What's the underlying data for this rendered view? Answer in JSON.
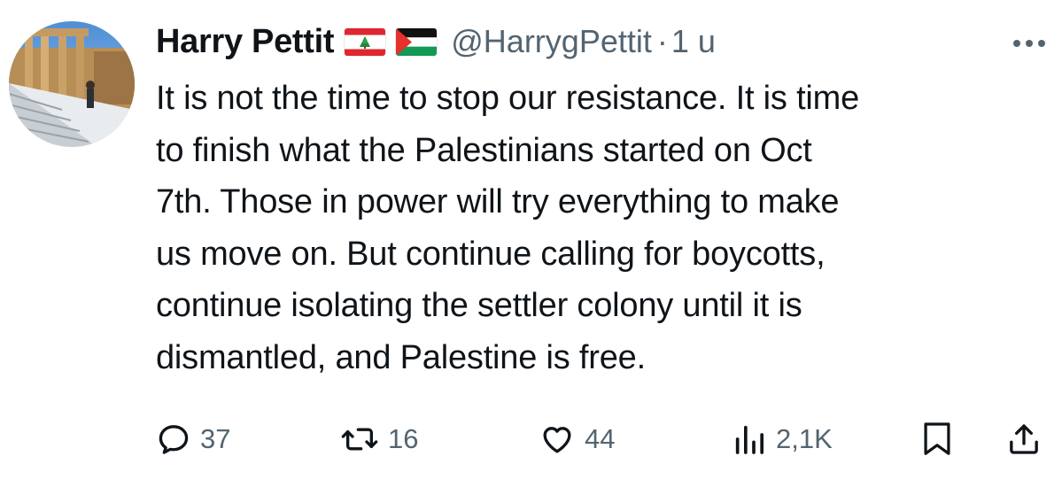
{
  "tweet": {
    "author": {
      "display_name": "Harry Pettit",
      "handle": "@HarrygPettit",
      "flags": [
        "lebanon-flag-icon",
        "palestine-flag-icon"
      ]
    },
    "separator": "·",
    "time": "1 u",
    "text": "It is not the time to stop our resistance. It is time to finish what the Palestinians started on Oct 7th. Those in power will try everything to make us move on. But continue calling for boycotts, continue isolating the settler colony until it is dismantled, and Palestine is free.",
    "text_lines": [
      "It is not the time to stop our resistance. It is time",
      "to finish what the Palestinians started on Oct",
      "7th. Those in power will try everything to make",
      "us move on. But continue calling for boycotts,",
      "continue isolating the settler colony until it is",
      "dismantled, and Palestine is free."
    ],
    "actions": {
      "reply": {
        "icon": "reply-icon",
        "count": "37"
      },
      "repost": {
        "icon": "repost-icon",
        "count": "16"
      },
      "like": {
        "icon": "heart-icon",
        "count": "44"
      },
      "views": {
        "icon": "views-icon",
        "count": "2,1K"
      },
      "bookmark": {
        "icon": "bookmark-icon"
      },
      "share": {
        "icon": "share-icon"
      }
    }
  },
  "colors": {
    "text_primary": "#0f1419",
    "text_secondary": "#536471"
  }
}
